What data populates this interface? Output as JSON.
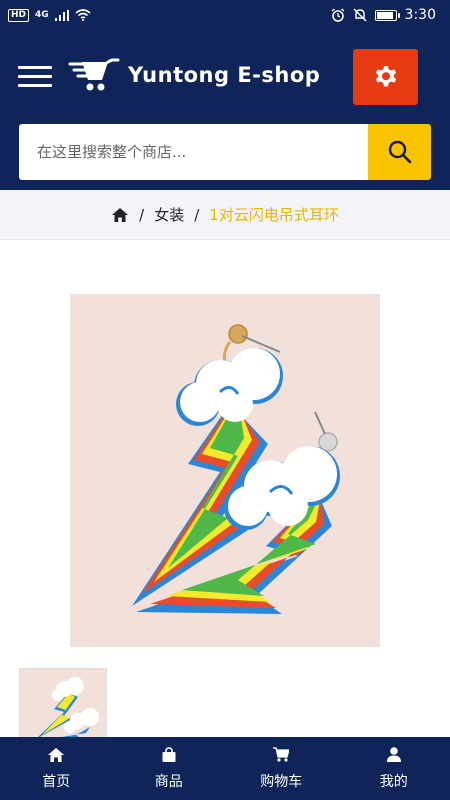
{
  "status_bar": {
    "badge": "HD",
    "network": "4G",
    "time": "3:30"
  },
  "header": {
    "app_name": "Yuntong E-shop",
    "menu_icon": "hamburger-icon",
    "settings_icon": "gear-icon"
  },
  "search": {
    "placeholder": "在这里搜索整个商店...",
    "icon": "search-icon"
  },
  "breadcrumb": {
    "home_icon": "home-icon",
    "separator": "/",
    "category": "女装",
    "current": "1对云闪电吊式耳环"
  },
  "product": {
    "image": "earrings-image",
    "thumbnail": "earrings-thumbnail"
  },
  "bottom_nav": {
    "items": [
      {
        "label": "首页",
        "icon": "home-icon"
      },
      {
        "label": "商品",
        "icon": "shopping-bag-icon"
      },
      {
        "label": "购物车",
        "icon": "cart-icon"
      },
      {
        "label": "我的",
        "icon": "user-icon"
      }
    ]
  },
  "colors": {
    "navy": "#0f2458",
    "settings_red": "#e63b12",
    "search_yellow": "#f8c300",
    "breadcrumb_current": "#e8b400"
  }
}
